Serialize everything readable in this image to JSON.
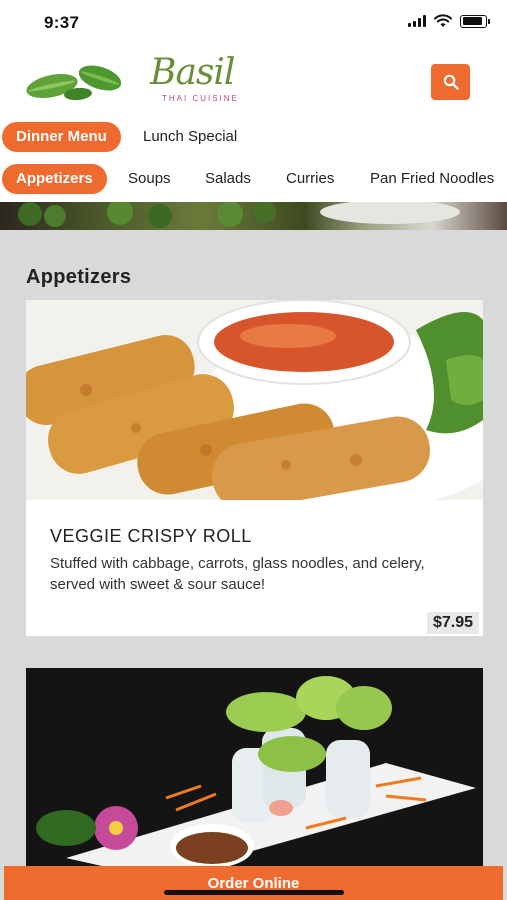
{
  "status_bar": {
    "time": "9:37",
    "battery_level": 0.9
  },
  "header": {
    "logo_text": "Basil",
    "logo_subtext": "THAI CUISINE",
    "brand_color": "#ef6a2f",
    "search_icon": "search-icon"
  },
  "menu_types": [
    {
      "label": "Dinner Menu",
      "active": true
    },
    {
      "label": "Lunch Special",
      "active": false
    }
  ],
  "categories": [
    {
      "label": "Appetizers",
      "active": true
    },
    {
      "label": "Soups",
      "active": false
    },
    {
      "label": "Salads",
      "active": false
    },
    {
      "label": "Curries",
      "active": false
    },
    {
      "label": "Pan Fried Noodles",
      "active": false
    }
  ],
  "section": {
    "title": "Appetizers"
  },
  "items": [
    {
      "name": "VEGGIE CRISPY ROLL",
      "description": "Stuffed with cabbage, carrots, glass noodles, and celery, served with sweet & sour sauce!",
      "price": "$7.95"
    }
  ],
  "footer": {
    "order_label": "Order Online"
  }
}
